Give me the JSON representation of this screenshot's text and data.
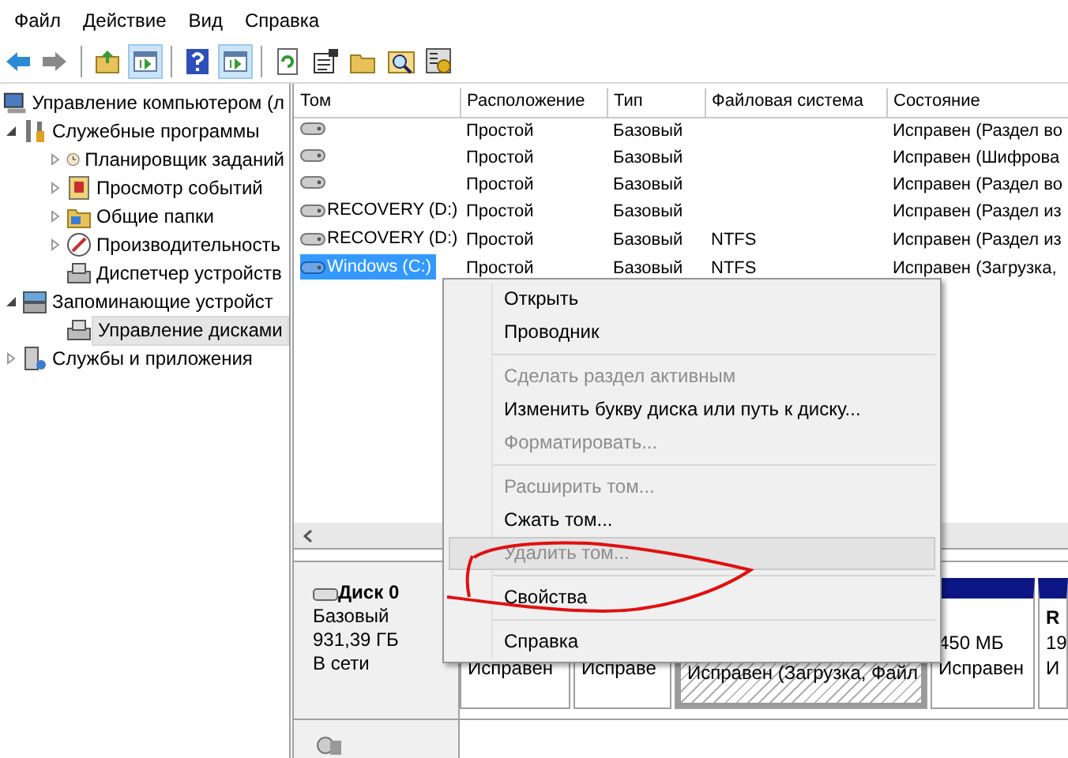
{
  "menu_bar": [
    "Файл",
    "Действие",
    "Вид",
    "Справка"
  ],
  "toolbar": [
    {
      "kind": "back",
      "pressed": false
    },
    {
      "kind": "forward",
      "pressed": false
    },
    {
      "kind": "separator"
    },
    {
      "kind": "up",
      "pressed": false
    },
    {
      "kind": "pane",
      "pressed": true
    },
    {
      "kind": "separator"
    },
    {
      "kind": "help",
      "pressed": false
    },
    {
      "kind": "pane",
      "pressed": true
    },
    {
      "kind": "separator"
    },
    {
      "kind": "refresh",
      "pressed": false
    },
    {
      "kind": "properties",
      "pressed": false
    },
    {
      "kind": "folder",
      "pressed": false
    },
    {
      "kind": "search",
      "pressed": false
    },
    {
      "kind": "settings",
      "pressed": false
    }
  ],
  "tree": [
    {
      "label": "Управление компьютером (л",
      "selected": false,
      "children": [
        {
          "label": "Служебные программы",
          "expanded": true,
          "selected": false,
          "children": [
            {
              "label": "Планировщик заданий",
              "expanded": false,
              "selected": false
            },
            {
              "label": "Просмотр событий",
              "expanded": false,
              "selected": false
            },
            {
              "label": "Общие папки",
              "expanded": false,
              "selected": false
            },
            {
              "label": "Производительность",
              "expanded": false,
              "selected": false
            },
            {
              "label": "Диспетчер устройств",
              "selected": false
            }
          ]
        },
        {
          "label": "Запоминающие устройст",
          "expanded": true,
          "selected": false,
          "children": [
            {
              "label": "Управление дисками",
              "selected": true
            }
          ]
        },
        {
          "label": "Службы и приложения",
          "expanded": false,
          "selected": false
        }
      ]
    }
  ],
  "table": {
    "columns": [
      "Том",
      "Расположение",
      "Тип",
      "Файловая система",
      "Состояние"
    ],
    "rows": [
      {
        "volume": "",
        "layout": "Простой",
        "type": "Базовый",
        "file_system": "",
        "status": "Исправен (Раздел во",
        "selected": false
      },
      {
        "volume": "",
        "layout": "Простой",
        "type": "Базовый",
        "file_system": "",
        "status": "Исправен (Шифрова",
        "selected": false
      },
      {
        "volume": "",
        "layout": "Простой",
        "type": "Базовый",
        "file_system": "",
        "status": "Исправен (Раздел во",
        "selected": false
      },
      {
        "volume": "RECOVERY (D:)",
        "layout": "Простой",
        "type": "Базовый",
        "file_system": "",
        "status": "Исправен (Раздел из",
        "selected": false
      },
      {
        "volume": "RECOVERY (D:)",
        "layout": "Простой",
        "type": "Базовый",
        "file_system": "NTFS",
        "status": "Исправен (Раздел из",
        "selected": false
      },
      {
        "volume": "Windows (C:)",
        "layout": "Простой",
        "type": "Базовый",
        "file_system": "NTFS",
        "status": "Исправен (Загрузка,",
        "selected": true
      }
    ]
  },
  "disk": {
    "name": "Диск 0",
    "type": "Базовый",
    "size": "931,39 ГБ",
    "state": "В сети",
    "partitions": [
      {
        "status": "Исправен",
        "selected": false
      },
      {
        "status": "Исправе",
        "selected": false
      },
      {
        "status": "Исправен (Загрузка, Файл",
        "selected": true
      },
      {
        "size": "450 МБ",
        "status": "Исправен",
        "selected": false
      },
      {
        "name": "R",
        "size": "19",
        "status": "И",
        "selected": false
      }
    ]
  },
  "context_menu": [
    {
      "kind": "item",
      "label": "Открыть",
      "disabled": false,
      "selected": false
    },
    {
      "kind": "item",
      "label": "Проводник",
      "disabled": false,
      "selected": false
    },
    {
      "kind": "separator"
    },
    {
      "kind": "item",
      "label": "Сделать раздел активным",
      "disabled": true,
      "selected": false
    },
    {
      "kind": "item",
      "label": "Изменить букву диска или путь к диску...",
      "disabled": false,
      "selected": false
    },
    {
      "kind": "item",
      "label": "Форматировать...",
      "disabled": true,
      "selected": false
    },
    {
      "kind": "separator"
    },
    {
      "kind": "item",
      "label": "Расширить том...",
      "disabled": true,
      "selected": false
    },
    {
      "kind": "item",
      "label": "Сжать том...",
      "disabled": false,
      "selected": false
    },
    {
      "kind": "item",
      "label": "Удалить том...",
      "disabled": true,
      "selected": true
    },
    {
      "kind": "separator"
    },
    {
      "kind": "item",
      "label": "Свойства",
      "disabled": false,
      "selected": false
    },
    {
      "kind": "separator"
    },
    {
      "kind": "item",
      "label": "Справка",
      "disabled": false,
      "selected": false
    }
  ]
}
